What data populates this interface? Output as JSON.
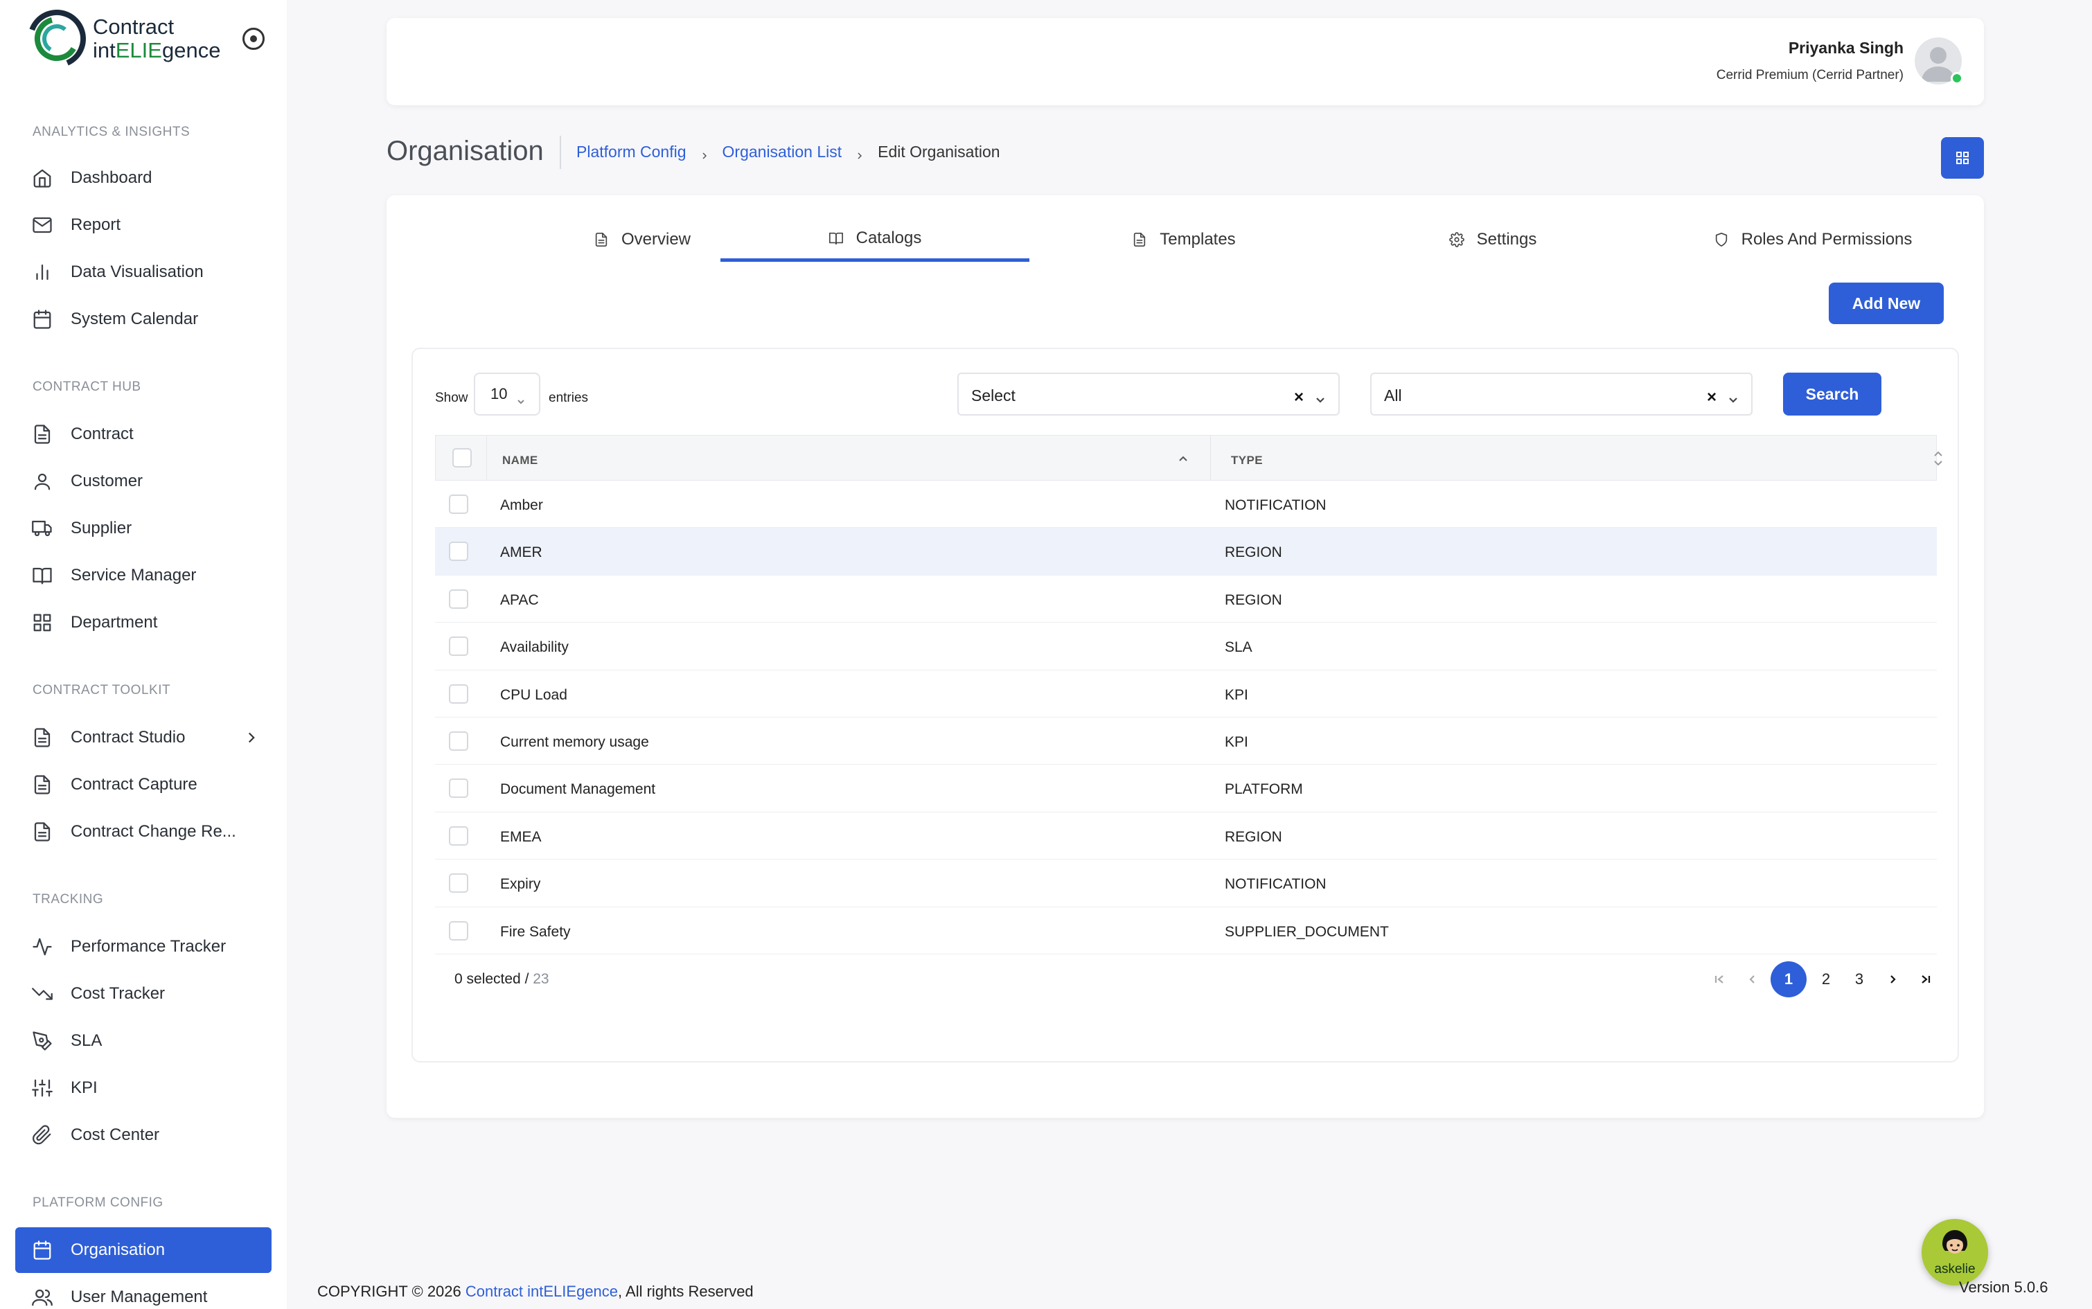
{
  "brand": {
    "line1": "Contract",
    "line2_prefix": "int",
    "line2_highlight": "ELIE",
    "line2_suffix": "gence"
  },
  "sidebar": {
    "sections": [
      {
        "title": "ANALYTICS & INSIGHTS",
        "items": [
          {
            "label": "Dashboard",
            "icon": "home-icon"
          },
          {
            "label": "Report",
            "icon": "mail-icon"
          },
          {
            "label": "Data Visualisation",
            "icon": "bar-chart-icon"
          },
          {
            "label": "System Calendar",
            "icon": "calendar-icon"
          }
        ]
      },
      {
        "title": "CONTRACT HUB",
        "items": [
          {
            "label": "Contract",
            "icon": "file-icon"
          },
          {
            "label": "Customer",
            "icon": "user-icon"
          },
          {
            "label": "Supplier",
            "icon": "truck-icon"
          },
          {
            "label": "Service Manager",
            "icon": "book-icon"
          },
          {
            "label": "Department",
            "icon": "grid-icon"
          }
        ]
      },
      {
        "title": "CONTRACT TOOLKIT",
        "items": [
          {
            "label": "Contract Studio",
            "icon": "file-icon"
          },
          {
            "label": "Contract Capture",
            "icon": "file-icon"
          },
          {
            "label": "Contract Change Re...",
            "icon": "file-icon"
          }
        ]
      },
      {
        "title": "TRACKING",
        "items": [
          {
            "label": "Performance Tracker",
            "icon": "activity-icon"
          },
          {
            "label": "Cost Tracker",
            "icon": "trending-down-icon"
          },
          {
            "label": "SLA",
            "icon": "pen-tool-icon"
          },
          {
            "label": "KPI",
            "icon": "sliders-icon"
          },
          {
            "label": "Cost Center",
            "icon": "paperclip-icon"
          }
        ]
      },
      {
        "title": "PLATFORM CONFIG",
        "items": [
          {
            "label": "Organisation",
            "icon": "calendar-icon"
          },
          {
            "label": "User Management",
            "icon": "users-icon"
          }
        ]
      }
    ]
  },
  "header": {
    "user_name": "Priyanka Singh",
    "user_role": "Cerrid Premium (Cerrid Partner)"
  },
  "page": {
    "title": "Organisation",
    "breadcrumb": [
      "Platform Config",
      "Organisation List",
      "Edit Organisation"
    ]
  },
  "tabs": [
    {
      "label": "Overview",
      "icon": "file-text-icon"
    },
    {
      "label": "Catalogs",
      "icon": "book-open-icon"
    },
    {
      "label": "Templates",
      "icon": "file-text-icon"
    },
    {
      "label": "Settings",
      "icon": "gear-icon"
    },
    {
      "label": "Roles And Permissions",
      "icon": "shield-icon"
    }
  ],
  "toolbar": {
    "add_label": "Add New"
  },
  "filters": {
    "show_label": "Show",
    "entries_value": "10",
    "entries_label": "entries",
    "select1_value": "Select",
    "select2_value": "All",
    "clear_symbol": "×",
    "search_label": "Search"
  },
  "table": {
    "columns": [
      "NAME",
      "TYPE"
    ],
    "rows": [
      {
        "name": "Amber",
        "type": "NOTIFICATION"
      },
      {
        "name": "AMER",
        "type": "REGION"
      },
      {
        "name": "APAC",
        "type": "REGION"
      },
      {
        "name": "Availability",
        "type": "SLA"
      },
      {
        "name": "CPU Load",
        "type": "KPI"
      },
      {
        "name": "Current memory usage",
        "type": "KPI"
      },
      {
        "name": "Document Management",
        "type": "PLATFORM"
      },
      {
        "name": "EMEA",
        "type": "REGION"
      },
      {
        "name": "Expiry",
        "type": "NOTIFICATION"
      },
      {
        "name": "Fire Safety",
        "type": "SUPPLIER_DOCUMENT"
      }
    ],
    "selected_text": "0 selected / ",
    "total": "23"
  },
  "pagination": {
    "pages": [
      "1",
      "2",
      "3"
    ],
    "current": "1"
  },
  "footer": {
    "prefix": "COPYRIGHT © 2026 ",
    "link": "Contract intELIEgence",
    "suffix": ", All rights Reserved"
  },
  "version": "Version 5.0.6",
  "assistant": {
    "label": "askelie"
  },
  "colors": {
    "accent": "#2e5fd8",
    "brand_green": "#1c8a3c",
    "online": "#2bc45a",
    "assistant_bg": "#a9c936"
  }
}
